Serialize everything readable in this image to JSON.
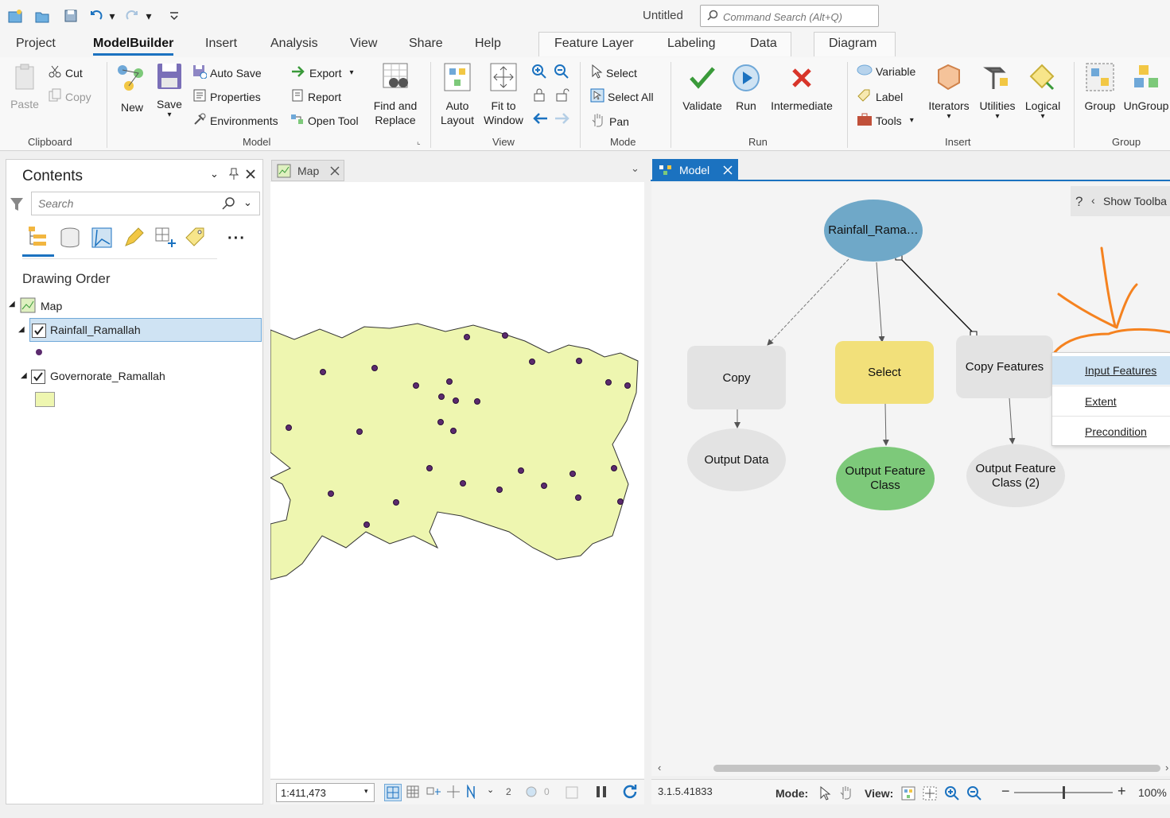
{
  "window": {
    "title": "Untitled"
  },
  "search": {
    "placeholder": "Command Search (Alt+Q)"
  },
  "tabs": [
    "Project",
    "ModelBuilder",
    "Insert",
    "Analysis",
    "View",
    "Share",
    "Help"
  ],
  "context_tabs": [
    "Feature Layer",
    "Labeling",
    "Data",
    "Diagram"
  ],
  "ribbon": {
    "clipboard": {
      "paste": "Paste",
      "cut": "Cut",
      "copy": "Copy",
      "group": "Clipboard"
    },
    "model": {
      "new": "New",
      "save": "Save",
      "auto_save": "Auto Save",
      "properties": "Properties",
      "environments": "Environments",
      "export": "Export",
      "report": "Report",
      "open_tool": "Open Tool",
      "find_replace_1": "Find and",
      "find_replace_2": "Replace",
      "group": "Model"
    },
    "view": {
      "auto_layout_1": "Auto",
      "auto_layout_2": "Layout",
      "fit_window_1": "Fit to",
      "fit_window_2": "Window",
      "group": "View"
    },
    "mode": {
      "select": "Select",
      "select_all": "Select All",
      "pan": "Pan",
      "group": "Mode"
    },
    "run": {
      "validate": "Validate",
      "run": "Run",
      "intermediate": "Intermediate",
      "group": "Run"
    },
    "insert": {
      "variable": "Variable",
      "label": "Label",
      "tools": "Tools",
      "iterators": "Iterators",
      "utilities": "Utilities",
      "logical": "Logical",
      "group": "Insert"
    },
    "group_sec": {
      "group": "Group",
      "ungroup": "UnGroup",
      "group_label": "Group"
    }
  },
  "contents": {
    "title": "Contents",
    "search_placeholder": "Search",
    "drawing_order": "Drawing Order",
    "map": "Map",
    "layers": [
      "Rainfall_Ramallah",
      "Governorate_Ramallah"
    ],
    "colors": {
      "point": "#5b2a6e",
      "polygon": "#eef6b0"
    }
  },
  "map_tab": {
    "label": "Map",
    "scale": "1:411,473",
    "selected_count": "0",
    "page": "2"
  },
  "model_tab": {
    "label": "Model",
    "show_toolbar": "Show Toolba",
    "help": "?",
    "nodes": {
      "input": "Rainfall_Rama…",
      "copy": "Copy",
      "select": "Select",
      "copy_features": "Copy Features",
      "output_data": "Output Data",
      "output_fc_1": "Output Feature",
      "output_fc_2": "Class",
      "output_fc2_1": "Output Feature",
      "output_fc2_2": "Class (2)"
    },
    "context_menu": [
      "Input Features",
      "Extent",
      "Precondition"
    ],
    "status": {
      "version": "3.1.5.41833",
      "mode": "Mode:",
      "view": "View:",
      "zoom": "100%"
    },
    "colors": {
      "input": "#6fa8c8",
      "select": "#f2e07a",
      "output_green": "#7dc97a",
      "tool_grey": "#e3e3e3",
      "annotation": "#f5821f"
    }
  }
}
